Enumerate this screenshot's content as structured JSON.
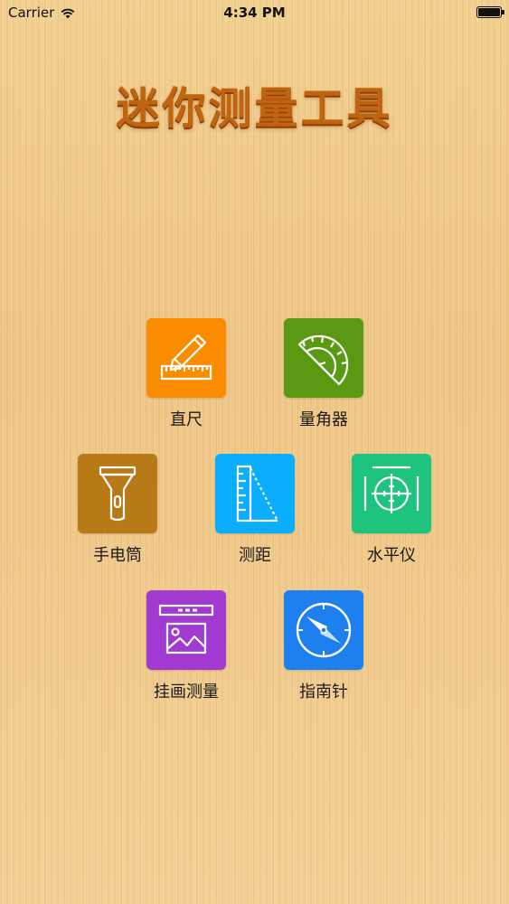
{
  "status_bar": {
    "carrier": "Carrier",
    "time": "4:34 PM"
  },
  "app": {
    "title": "迷你测量工具"
  },
  "tools": [
    {
      "id": "ruler",
      "label": "直尺",
      "icon": "ruler-pencil-icon",
      "color": "#fb8c00"
    },
    {
      "id": "protractor",
      "label": "量角器",
      "icon": "protractor-icon",
      "color": "#5a9a12"
    },
    {
      "id": "flashlight",
      "label": "手电筒",
      "icon": "flashlight-icon",
      "color": "#b87a16"
    },
    {
      "id": "distance",
      "label": "测距",
      "icon": "triangle-ruler-icon",
      "color": "#0aaefc"
    },
    {
      "id": "level",
      "label": "水平仪",
      "icon": "level-crosshair-icon",
      "color": "#1ec47e"
    },
    {
      "id": "picture",
      "label": "挂画测量",
      "icon": "picture-frame-icon",
      "color": "#a23ad1"
    },
    {
      "id": "compass",
      "label": "指南针",
      "icon": "compass-icon",
      "color": "#1e7fee"
    }
  ]
}
